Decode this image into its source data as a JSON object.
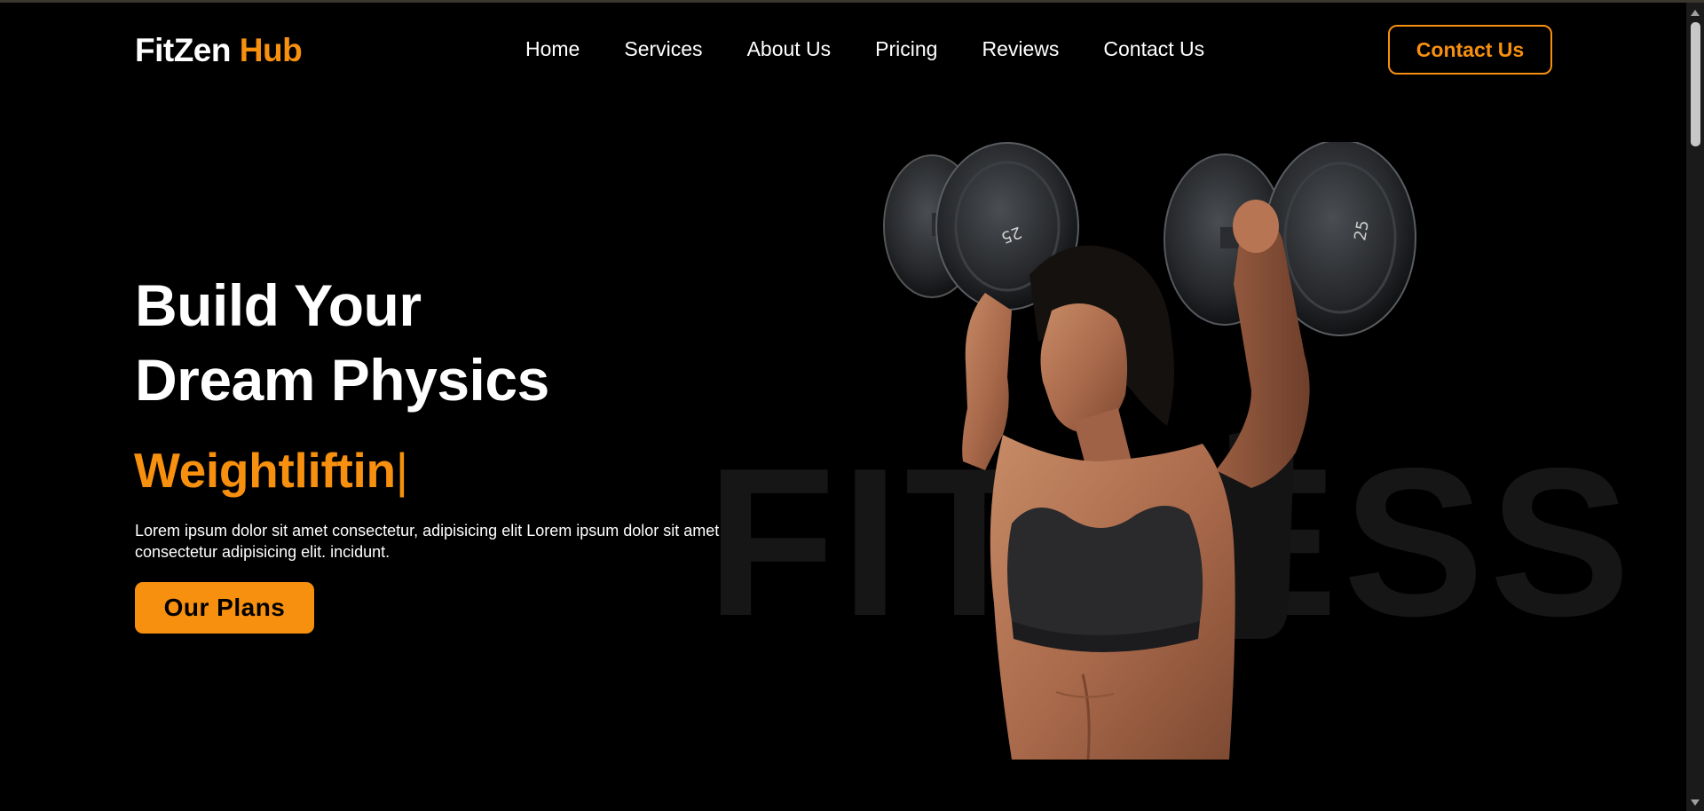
{
  "header": {
    "logo_main": "FitZen",
    "logo_accent": "Hub",
    "nav": [
      "Home",
      "Services",
      "About Us",
      "Pricing",
      "Reviews",
      "Contact Us"
    ],
    "cta_label": "Contact Us"
  },
  "hero": {
    "title_line1": "Build Your",
    "title_line2": "Dream Physics",
    "typed_text": "Weightliftin",
    "typed_cursor": "|",
    "description": "Lorem ipsum dolor sit amet consectetur, adipisicing elit Lorem ipsum dolor sit amet consectetur adipisicing elit. incidunt.",
    "button_label": "Our Plans",
    "background_word": "FITNESS",
    "dumbbell_weight_left": "25",
    "dumbbell_weight_right": "25"
  },
  "colors": {
    "background": "#000000",
    "accent": "#f7900f",
    "text": "#ffffff",
    "background_word": "#161616"
  }
}
